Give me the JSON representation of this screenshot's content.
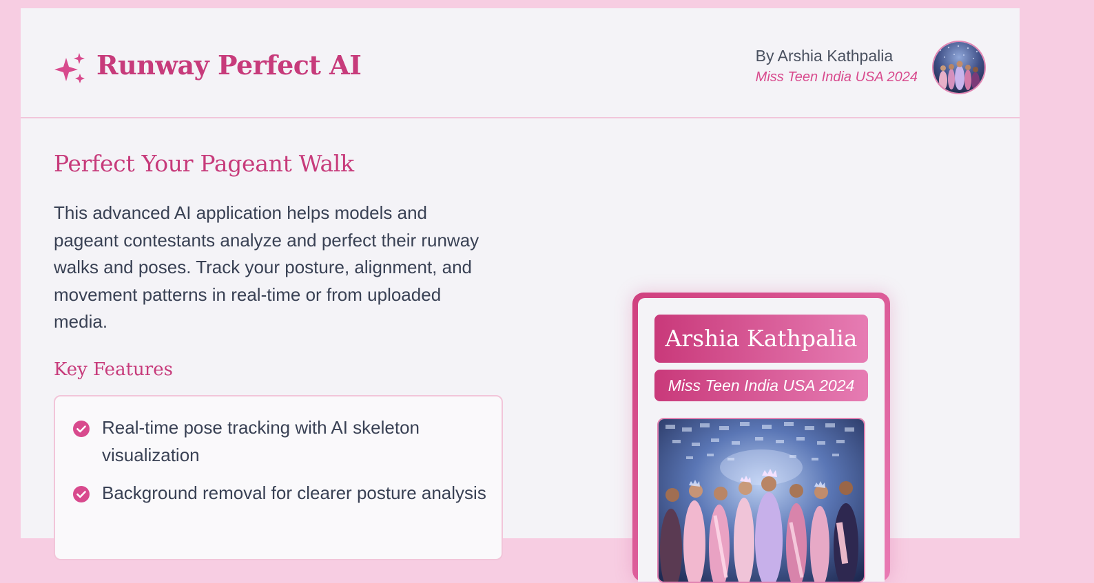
{
  "header": {
    "app_title": "Runway Perfect AI",
    "logo_icon": "sparkles-icon",
    "author_name": "By Arshia Kathpalia",
    "author_subtitle": "Miss Teen India USA 2024",
    "avatar_icon": "avatar-photo"
  },
  "main": {
    "section_title": "Perfect Your Pageant Walk",
    "intro": "This advanced AI application helps models and pageant contestants analyze and perfect their runway walks and poses. Track your posture, alignment, and movement patterns in real-time or from uploaded media.",
    "features_title": "Key Features",
    "features": [
      {
        "text": "Real-time pose tracking with AI skeleton visualization",
        "icon": "check-circle-icon"
      },
      {
        "text": "Background removal for clearer posture analysis",
        "icon": "check-circle-icon"
      }
    ]
  },
  "profile_card": {
    "name": "Arshia Kathpalia",
    "title": "Miss Teen India USA 2024",
    "photo_icon": "pageant-photo"
  },
  "colors": {
    "accent": "#c73b7b",
    "accent_light": "#e67cb3",
    "page_background": "#f7cde2",
    "panel_background": "#f4f3f7",
    "text": "#394154"
  }
}
